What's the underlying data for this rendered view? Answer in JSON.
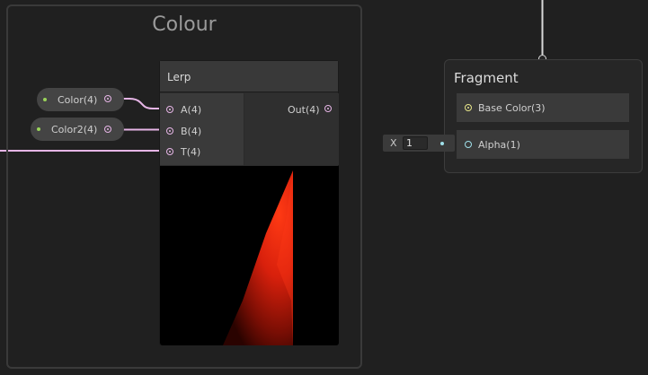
{
  "group": {
    "title": "Colour"
  },
  "properties": [
    {
      "label": "Color(4)"
    },
    {
      "label": "Color2(4)"
    }
  ],
  "lerp_node": {
    "title": "Lerp",
    "inputs": [
      "A(4)",
      "B(4)",
      "T(4)"
    ],
    "output": "Out(4)"
  },
  "fragment_node": {
    "title": "Fragment",
    "slots": [
      "Base Color(3)",
      "Alpha(1)"
    ]
  },
  "alpha_input": {
    "axis_label": "X",
    "value": "1"
  },
  "colors": {
    "wire_vector4": "#e6b5e6",
    "wire_vector3": "#e8e68a",
    "wire_float": "#9fe0ea",
    "property_dot": "#9ad35a"
  }
}
